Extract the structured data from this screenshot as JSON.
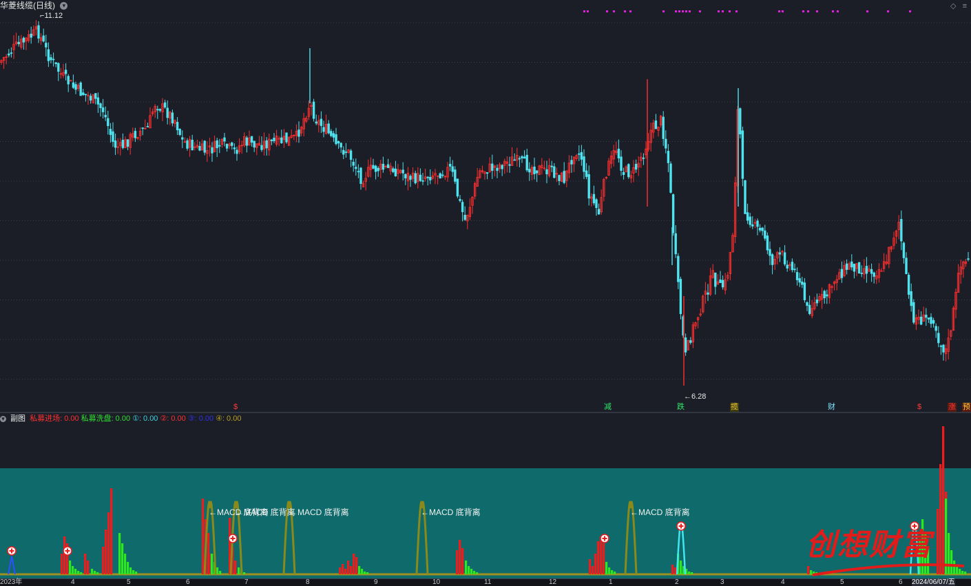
{
  "header": {
    "stock_name": "华菱线缆(日线)",
    "high_label": "11.12",
    "low_label": "6.28"
  },
  "signals": [
    {
      "text": "$",
      "color": "#ff3b3b"
    },
    {
      "text": "减",
      "color": "#2ee66b"
    },
    {
      "text": "跌",
      "color": "#2ee66b"
    },
    {
      "text": "揽",
      "color": "#ffd23a"
    },
    {
      "text": "财",
      "color": "#7fe3ff"
    },
    {
      "text": "$",
      "color": "#ff3b3b"
    },
    {
      "text": "涨",
      "color": "#ff3b3b"
    },
    {
      "text": "预",
      "color": "#ffd23a"
    }
  ],
  "sub_header": {
    "title": "副图",
    "items": [
      {
        "label": "私募进场:",
        "value": "0.00",
        "color": "#ff3030"
      },
      {
        "label": "私募洗盘:",
        "value": "0.00",
        "color": "#30e030"
      },
      {
        "label": "①:",
        "value": "0.00",
        "color": "#40d0e0"
      },
      {
        "label": "②:",
        "value": "0.00",
        "color": "#ff3030"
      },
      {
        "label": "③:",
        "value": "0.00",
        "color": "#3030e0"
      },
      {
        "label": "④:",
        "value": "0.00",
        "color": "#b8a020"
      }
    ]
  },
  "annotations": [
    "←MACD 底背离",
    "←MACD 底背离",
    "←MACD 底背离",
    "←MACD 底背离",
    "←MACD 底背离"
  ],
  "x_axis": {
    "ticks": [
      "2023年",
      "4",
      "5",
      "6",
      "7",
      "8",
      "9",
      "10",
      "11",
      "12",
      "1",
      "2",
      "3",
      "4",
      "5",
      "6",
      "2024/06/07/五"
    ]
  },
  "watermark": "创想财富",
  "colors": {
    "up": "#ff3030",
    "down": "#4fe3ef",
    "background": "#1b1e27",
    "sub_band": "#0f6b6b"
  }
}
